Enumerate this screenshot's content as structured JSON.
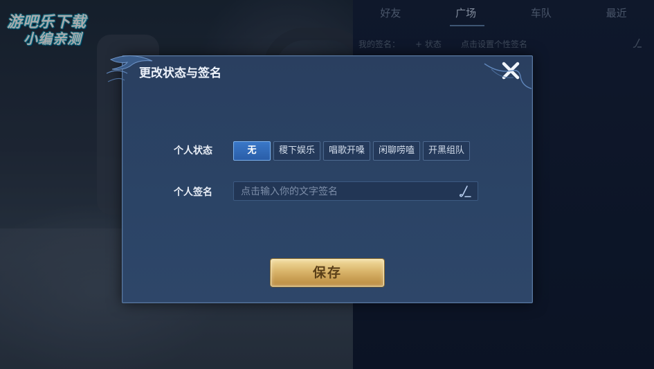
{
  "logo": {
    "line1": "游吧乐下载",
    "line2": "小编亲测"
  },
  "right_panel": {
    "tabs": [
      {
        "label": "好友",
        "active": false
      },
      {
        "label": "广场",
        "active": true
      },
      {
        "label": "车队",
        "active": false
      },
      {
        "label": "最近",
        "active": false
      }
    ],
    "signature_row": {
      "label": "我的签名：",
      "status_action": "+ 状态",
      "placeholder": "点击设置个性签名",
      "icon": "pen-icon"
    }
  },
  "dialog": {
    "title": "更改状态与签名",
    "close_icon": "close-icon",
    "status": {
      "label": "个人状态",
      "options": [
        "无",
        "稷下娱乐",
        "唱歌开嗓",
        "闲聊唠嗑",
        "开黑组队"
      ],
      "selected": "无"
    },
    "signature": {
      "label": "个人签名",
      "placeholder": "点击输入你的文字签名",
      "value": "",
      "icon": "pen-icon"
    },
    "save_label": "保存"
  },
  "colors": {
    "dialog_bg": "#2b4466",
    "selected_option": "#2a5ea8",
    "save_button": "#d9b46a",
    "logo_outline": "#1bd3e6"
  }
}
